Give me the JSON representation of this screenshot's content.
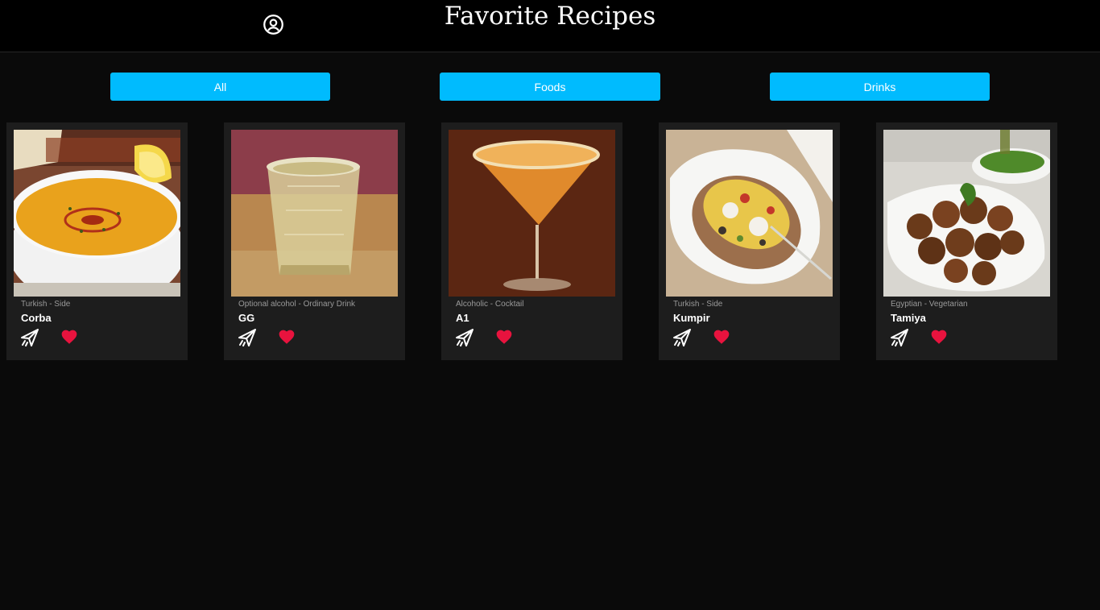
{
  "header": {
    "title": "Favorite Recipes",
    "profile_icon": "profile-icon"
  },
  "filters": [
    {
      "label": "All"
    },
    {
      "label": "Foods"
    },
    {
      "label": "Drinks"
    }
  ],
  "recipes": [
    {
      "category": "Turkish - Side",
      "name": "Corba",
      "image": "lentil-soup-image"
    },
    {
      "category": "Optional alcohol - Ordinary Drink",
      "name": "GG",
      "image": "glass-drink-image"
    },
    {
      "category": "Alcoholic - Cocktail",
      "name": "A1",
      "image": "cocktail-image"
    },
    {
      "category": "Turkish - Side",
      "name": "Kumpir",
      "image": "stuffed-potato-image"
    },
    {
      "category": "Egyptian - Vegetarian",
      "name": "Tamiya",
      "image": "falafel-image"
    }
  ],
  "icons": {
    "share": "share-icon",
    "favorite": "heart-icon"
  },
  "colors": {
    "header_bg": "#000000",
    "page_bg": "#0a0a0a",
    "card_bg": "#1d1d1d",
    "filter_button": "#00bbfe",
    "heart": "#e8133e"
  }
}
